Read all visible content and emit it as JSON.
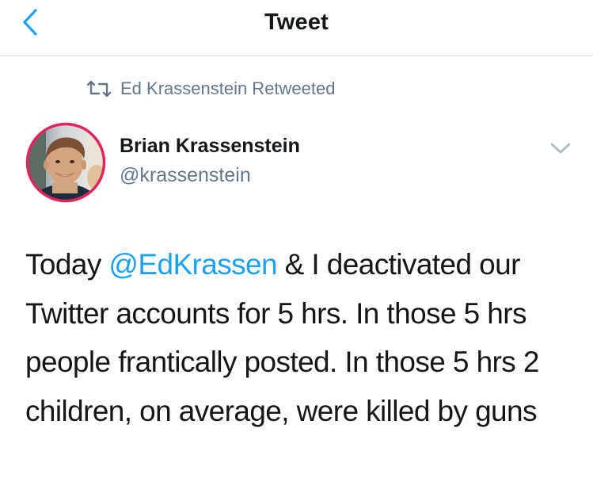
{
  "nav": {
    "title": "Tweet"
  },
  "retweet_context": {
    "label": "Ed Krassenstein Retweeted"
  },
  "author": {
    "name": "Brian Krassenstein",
    "handle": "@krassenstein"
  },
  "tweet": {
    "text_before_mention": "Today ",
    "mention": "@EdKrassen",
    "text_after_mention": " & I deactivated our Twitter accounts for 5 hrs. In those 5 hrs people frantically posted. In those 5 hrs 2 children, on average, were killed by guns"
  },
  "icons": {
    "back": "chevron-left-icon",
    "retweet": "retweet-icon",
    "caret": "chevron-down-icon"
  },
  "colors": {
    "accent": "#1da1f2",
    "secondary_text": "#657786",
    "primary_text": "#14171a",
    "avatar_border": "#e0245e",
    "divider": "#d8dde1"
  }
}
